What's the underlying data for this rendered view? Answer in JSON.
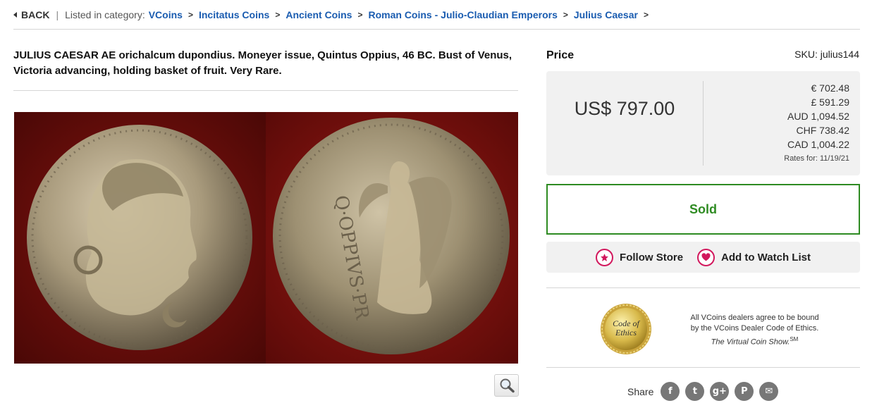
{
  "breadcrumb": {
    "back_label": "BACK",
    "listed_label": "Listed in category:",
    "items": [
      "VCoins",
      "Incitatus Coins",
      "Ancient Coins",
      "Roman Coins - Julio-Claudian Emperors",
      "Julius Caesar"
    ]
  },
  "product": {
    "title": "JULIUS CAESAR AE orichalcum dupondius. Moneyer issue, Quintus Oppius, 46 BC. Bust of Venus, Victoria advancing, holding basket of fruit. Very Rare.",
    "image_reverse_legend": "Q·OPPIVS·PR"
  },
  "pricing": {
    "label": "Price",
    "sku": "SKU: julius144",
    "main": "US$ 797.00",
    "conversions": [
      "€ 702.48",
      "£ 591.29",
      "AUD 1,094.52",
      "CHF 738.42",
      "CAD 1,004.22"
    ],
    "rates_date": "Rates for: 11/19/21"
  },
  "status": {
    "label": "Sold",
    "color": "#2e8b22"
  },
  "actions": {
    "follow_label": "Follow Store",
    "watch_label": "Add to Watch List",
    "accent": "#d2185d"
  },
  "ethics": {
    "seal_text_1": "Code of",
    "seal_text_2": "Ethics",
    "line1": "All VCoins dealers agree to be bound",
    "line2": "by the VCoins Dealer Code of Ethics.",
    "line3": "The Virtual Coin Show.",
    "mark": "SM"
  },
  "share": {
    "label": "Share",
    "icons": [
      {
        "name": "facebook-icon",
        "glyph": "f"
      },
      {
        "name": "twitter-icon",
        "glyph": "t"
      },
      {
        "name": "googleplus-icon",
        "glyph": "g+"
      },
      {
        "name": "pinterest-icon",
        "glyph": "P"
      },
      {
        "name": "email-icon",
        "glyph": "✉"
      }
    ]
  }
}
